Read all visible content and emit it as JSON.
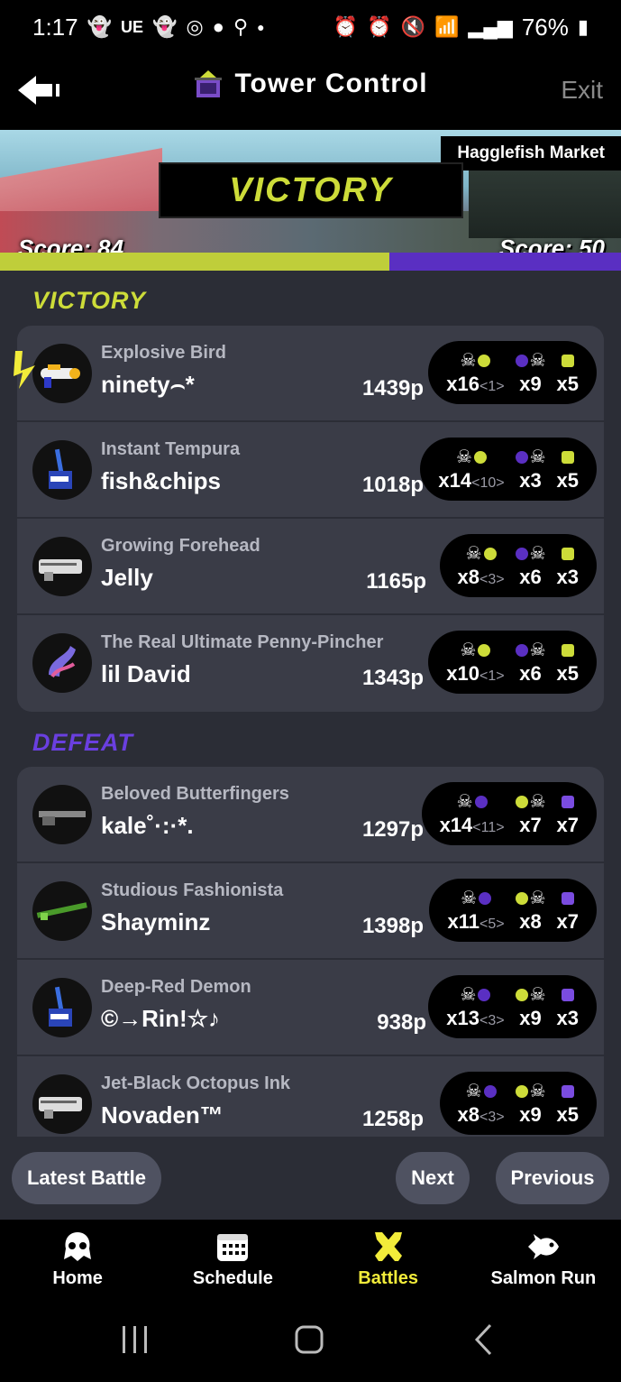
{
  "status_bar": {
    "time": "1:17",
    "carrier_text": "UE",
    "battery": "76%",
    "icons": [
      "snapchat-icon",
      "snapchat-icon",
      "instagram-icon",
      "account-icon",
      "steam-icon",
      "dot-icon",
      "alarm-battery-icon",
      "alarm-icon",
      "mute-icon",
      "wifi-icon",
      "signal-icon",
      "battery-icon"
    ]
  },
  "header": {
    "title": "Tower Control",
    "exit_label": "Exit"
  },
  "banner": {
    "stage": "Hagglefish Market",
    "result": "VICTORY",
    "score_left": "Score: 84",
    "score_right": "Score: 50",
    "score_left_fraction": 0.627
  },
  "colors": {
    "alpha": "#cddc39",
    "bravo": "#5a2fc2",
    "active_tab": "#f2ec3a"
  },
  "victory_team": {
    "label": "VICTORY",
    "players": [
      {
        "title": "Explosive Bird",
        "name": "ninety⌢*",
        "points": "1439p",
        "kills": "x16",
        "assists": "<1>",
        "specials": "x9",
        "special_count": "x5",
        "weapon": "splattershot-icon",
        "special_icon": "missile-icon"
      },
      {
        "title": "Instant Tempura",
        "name": "fish&chips",
        "points": "1018p",
        "kills": "x14",
        "assists": "<10>",
        "specials": "x3",
        "special_count": "x5",
        "weapon": "inkbrush-icon",
        "special_icon": "splashdown-icon"
      },
      {
        "title": "Growing Forehead",
        "name": "Jelly",
        "points": "1165p",
        "kills": "x8",
        "assists": "<3>",
        "specials": "x6",
        "special_count": "x3",
        "weapon": "splatling-icon",
        "special_icon": "booyah-icon"
      },
      {
        "title": "The Real Ultimate Penny-Pincher",
        "name": "lil David",
        "points": "1343p",
        "kills": "x10",
        "assists": "<1>",
        "specials": "x6",
        "special_count": "x5",
        "weapon": "slosher-icon",
        "special_icon": "missile-icon"
      }
    ]
  },
  "defeat_team": {
    "label": "DEFEAT",
    "players": [
      {
        "title": "Beloved Butterfingers",
        "name": "kale˚·:·*.",
        "points": "1297p",
        "kills": "x14",
        "assists": "<11>",
        "specials": "x7",
        "special_count": "x7",
        "weapon": "charger-icon",
        "special_icon": "armor-icon"
      },
      {
        "title": "Studious Fashionista",
        "name": "Shayminz",
        "points": "1398p",
        "kills": "x11",
        "assists": "<5>",
        "specials": "x8",
        "special_count": "x7",
        "weapon": "bamboozler-icon",
        "special_icon": "bubble-icon"
      },
      {
        "title": "Deep-Red Demon",
        "name": "©→Rin!☆♪",
        "points": "938p",
        "kills": "x13",
        "assists": "<3>",
        "specials": "x9",
        "special_count": "x3",
        "weapon": "inkbrush-icon",
        "special_icon": "booyah-icon"
      },
      {
        "title": "Jet-Black Octopus Ink",
        "name": "Novaden™",
        "points": "1258p",
        "kills": "x8",
        "assists": "<3>",
        "specials": "x9",
        "special_count": "x5",
        "weapon": "splatling-icon",
        "special_icon": "booyah-icon"
      }
    ]
  },
  "actions": {
    "latest": "Latest Battle",
    "next": "Next",
    "previous": "Previous"
  },
  "tabs": [
    {
      "label": "Home",
      "icon": "squid-icon"
    },
    {
      "label": "Schedule",
      "icon": "calendar-icon"
    },
    {
      "label": "Battles",
      "icon": "battles-icon"
    },
    {
      "label": "Salmon Run",
      "icon": "salmon-icon"
    }
  ]
}
